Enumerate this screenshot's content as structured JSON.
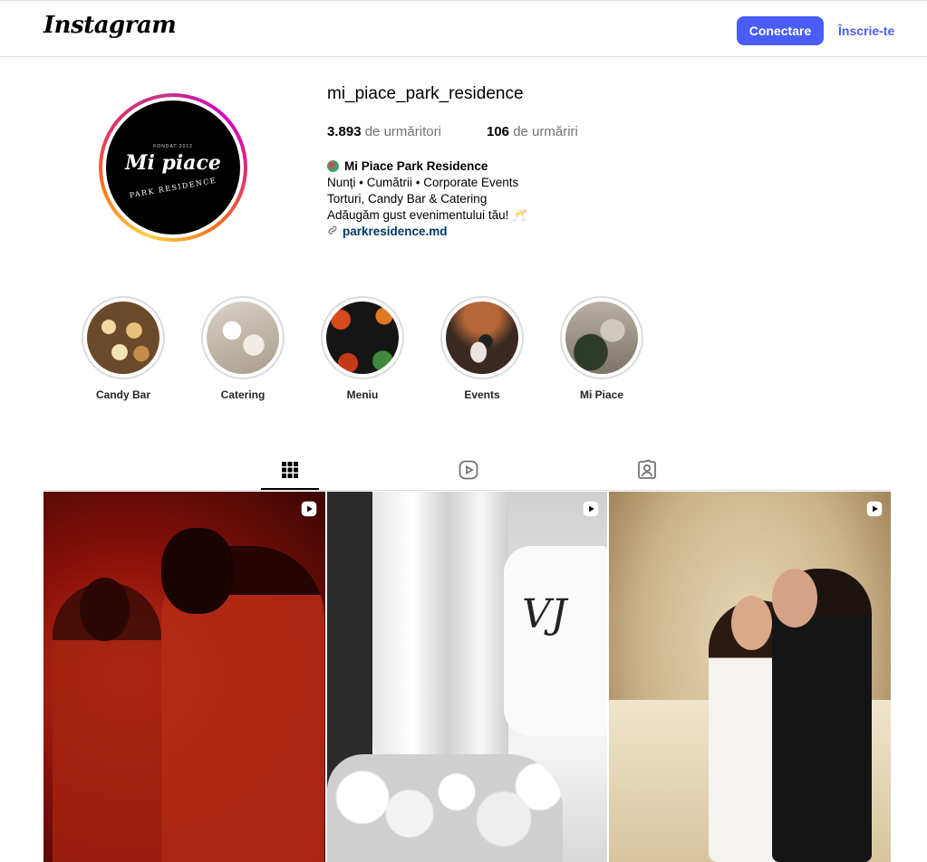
{
  "header": {
    "logo": "Instagram",
    "login_label": "Conectare",
    "signup_label": "Înscrie-te"
  },
  "profile": {
    "username": "mi_piace_park_residence",
    "followers_count": "3.893",
    "followers_label": "de urmăritori",
    "following_count": "106",
    "following_label": "de urmăriri",
    "avatar": {
      "tiny": "FONDAT 2012",
      "brand": "Mi piace",
      "sub": "PARK RESIDENCE"
    },
    "bio": {
      "name": "Mi Piace Park Residence",
      "line1": "Nunți • Cumătrii • Corporate Events",
      "line2": "Torturi, Candy Bar & Catering",
      "line3": "Adăugăm gust evenimentului tău! 🥂",
      "link": "parkresidence.md"
    }
  },
  "highlights": [
    {
      "label": "Candy Bar"
    },
    {
      "label": "Catering"
    },
    {
      "label": "Meniu"
    },
    {
      "label": "Events"
    },
    {
      "label": "Mi Piace"
    }
  ],
  "tabs": [
    {
      "icon": "grid-icon",
      "active": true
    },
    {
      "icon": "reels-icon",
      "active": false
    },
    {
      "icon": "tagged-icon",
      "active": false
    }
  ],
  "posts": [
    {
      "type": "reel",
      "icon": "reel-icon"
    },
    {
      "type": "reel",
      "icon": "reel-icon"
    },
    {
      "type": "reel",
      "icon": "reel-icon"
    }
  ]
}
